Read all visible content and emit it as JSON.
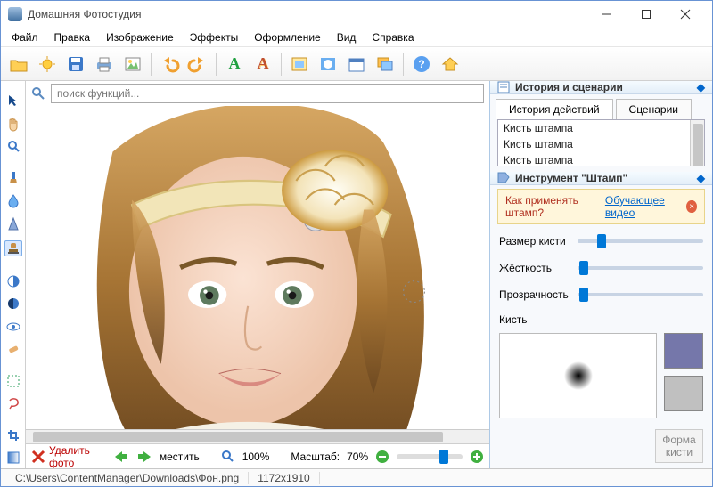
{
  "window": {
    "title": "Домашняя Фотостудия"
  },
  "menu": [
    "Файл",
    "Правка",
    "Изображение",
    "Эффекты",
    "Оформление",
    "Вид",
    "Справка"
  ],
  "search": {
    "placeholder": "поиск функций..."
  },
  "bottom": {
    "delete": "Удалить фото",
    "move": "местить",
    "fit": "100%",
    "scale_label": "Масштаб:",
    "scale_value": "70%"
  },
  "status": {
    "path": "C:\\Users\\ContentManager\\Downloads\\Фон.png",
    "dims": "1172x1910"
  },
  "panels": {
    "history": {
      "title": "История и сценарии",
      "tabs": [
        "История действий",
        "Сценарии"
      ],
      "items": [
        "Кисть штампа",
        "Кисть штампа",
        "Кисть штампа",
        "Кисть штампа",
        "Кисть штампа",
        "Кисть штампа",
        "Кисть штампа"
      ],
      "selected_index": 6
    },
    "tool": {
      "title": "Инструмент \"Штамп\"",
      "info_q": "Как применять штамп?",
      "info_link": "Обучающее видео",
      "sliders": {
        "size": "Размер кисти",
        "hardness": "Жёсткость",
        "opacity": "Прозрачность"
      },
      "brush_label": "Кисть",
      "shape_btn": "Форма кисти",
      "colors": {
        "primary": "#7577aa",
        "secondary": "#c0c0c0"
      }
    }
  }
}
